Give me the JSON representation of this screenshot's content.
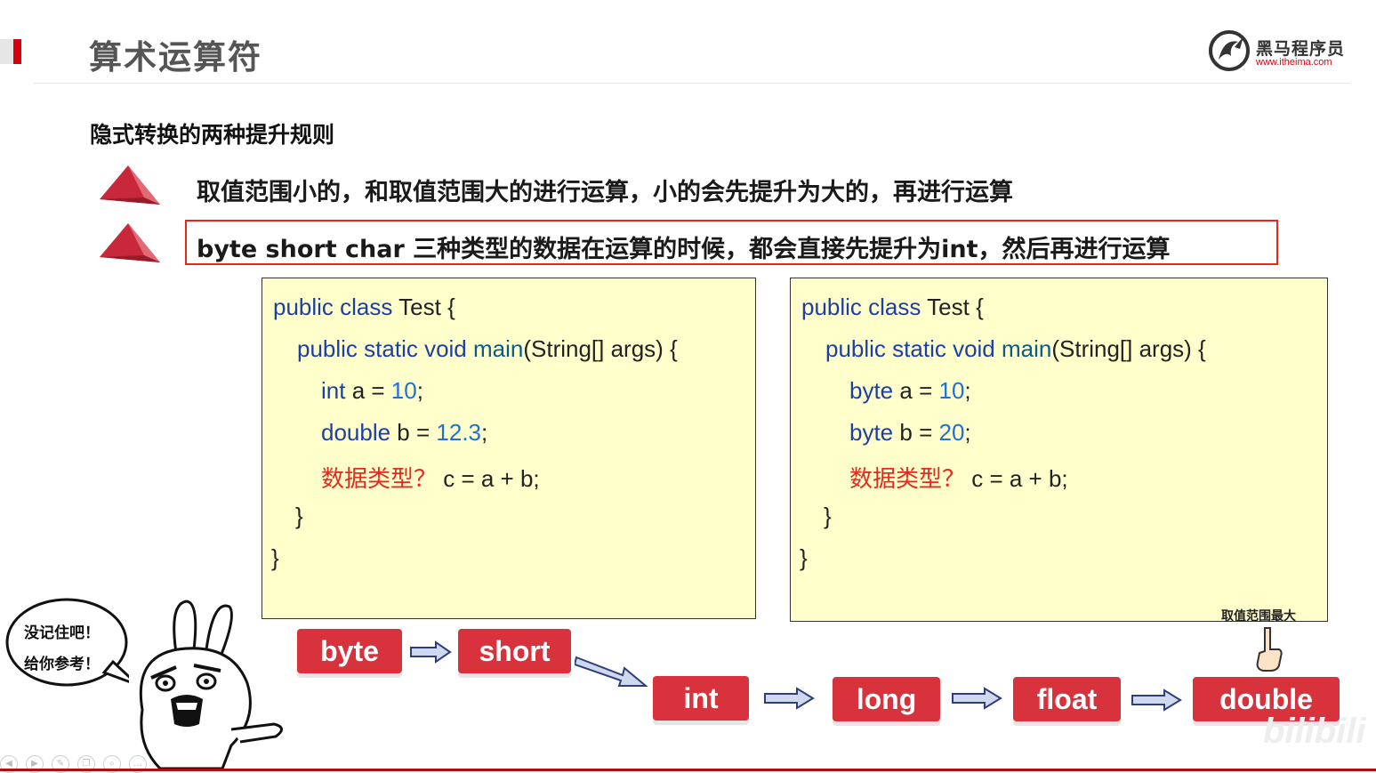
{
  "header": {
    "title": "算术运算符",
    "logo_text": "黑马程序员",
    "logo_url": "www.itheima.com"
  },
  "section": {
    "subtitle": "隐式转换的两种提升规则",
    "rules": [
      "取值范围小的，和取值范围大的进行运算，小的会先提升为大的，再进行运算",
      "byte short char 三种类型的数据在运算的时候，都会直接先提升为int，然后再进行运算"
    ]
  },
  "code_left": {
    "lines": [
      {
        "kw": "public class",
        "rest": " Test {"
      },
      {
        "kw": "public static void",
        "fn": " main",
        "rest": "(String[] args) {"
      },
      {
        "kw": "int",
        "rest1": " a = ",
        "num": "10",
        "rest2": ";"
      },
      {
        "kw": "double",
        "rest1": " b = ",
        "num": "12.3",
        "rest2": ";"
      },
      {
        "cn": "数据类型？",
        "rest": " c = a + b;"
      },
      {
        "rest": "}"
      },
      {
        "rest": "}"
      }
    ]
  },
  "code_right": {
    "lines": [
      {
        "kw": "public class",
        "rest": " Test {"
      },
      {
        "kw": "public static void",
        "fn": " main",
        "rest": "(String[] args) {"
      },
      {
        "kw": "byte",
        "rest1": " a = ",
        "num": "10",
        "rest2": ";"
      },
      {
        "kw": "byte",
        "rest1": " b = ",
        "num": "20",
        "rest2": ";"
      },
      {
        "cn": "数据类型？",
        "rest": "  c = a + b;"
      },
      {
        "rest": "}"
      },
      {
        "rest": "}"
      }
    ]
  },
  "type_chain": {
    "types": [
      "byte",
      "short",
      "int",
      "long",
      "float",
      "double"
    ],
    "max_label": "取值范围最大"
  },
  "bubble": {
    "line1": "没记住吧！",
    "line2": "给你参考！"
  },
  "watermark": "bilibili",
  "colors": {
    "accent_red": "#d7000f",
    "type_box": "#d8333c",
    "code_bg": "#ffffcc",
    "keyword": "#1d3fa5",
    "number": "#1e6fd9"
  }
}
